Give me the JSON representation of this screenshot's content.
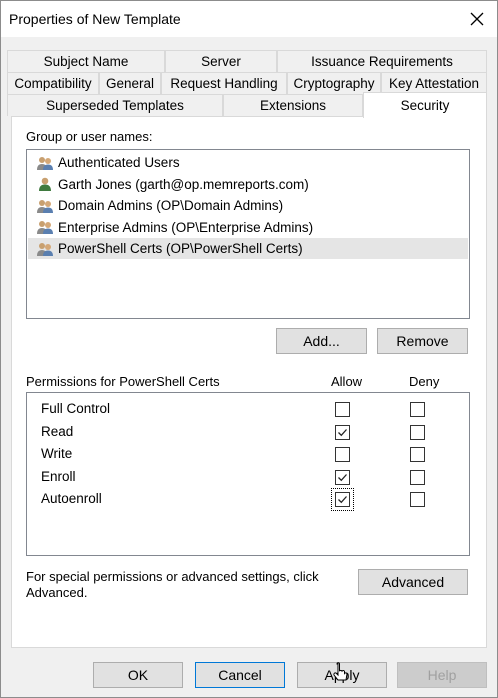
{
  "window": {
    "title": "Properties of New Template"
  },
  "tabs": {
    "row1": [
      "Subject Name",
      "Server",
      "Issuance Requirements"
    ],
    "row2": [
      "Compatibility",
      "General",
      "Request Handling",
      "Cryptography",
      "Key Attestation"
    ],
    "row3": [
      "Superseded Templates",
      "Extensions",
      "Security"
    ],
    "active": "Security"
  },
  "group_list": {
    "label": "Group or user names:",
    "items": [
      {
        "name": "Authenticated Users",
        "icon": "users-group-icon",
        "selected": false
      },
      {
        "name": "Garth Jones (garth@op.memreports.com)",
        "icon": "user-icon",
        "selected": false
      },
      {
        "name": "Domain Admins (OP\\Domain Admins)",
        "icon": "users-group-icon",
        "selected": false
      },
      {
        "name": "Enterprise Admins (OP\\Enterprise Admins)",
        "icon": "users-group-icon",
        "selected": false
      },
      {
        "name": "PowerShell Certs (OP\\PowerShell Certs)",
        "icon": "users-group-icon",
        "selected": true
      }
    ]
  },
  "buttons": {
    "add": "Add...",
    "remove": "Remove",
    "advanced": "Advanced",
    "ok": "OK",
    "cancel": "Cancel",
    "apply": "Apply",
    "help": "Help"
  },
  "permissions": {
    "label": "Permissions for PowerShell Certs",
    "allow_header": "Allow",
    "deny_header": "Deny",
    "rows": [
      {
        "name": "Full Control",
        "allow": false,
        "deny": false
      },
      {
        "name": "Read",
        "allow": true,
        "deny": false
      },
      {
        "name": "Write",
        "allow": false,
        "deny": false
      },
      {
        "name": "Enroll",
        "allow": true,
        "deny": false
      },
      {
        "name": "Autoenroll",
        "allow": true,
        "deny": false
      }
    ]
  },
  "advanced_text": {
    "line1": "For special permissions or advanced settings, click",
    "line2": "Advanced."
  },
  "colors": {
    "dialog_bg": "#f0f0f0",
    "focus_border": "#0078d7",
    "selected_row": "#e5e5e5"
  }
}
